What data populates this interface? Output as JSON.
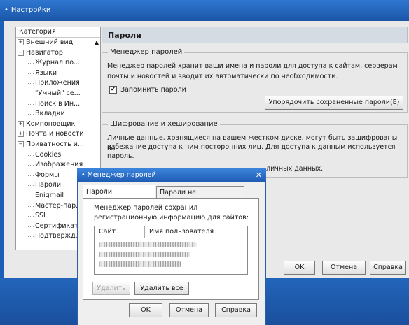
{
  "window": {
    "title": "Настройки"
  },
  "tree": {
    "header": "Категория",
    "items": [
      {
        "label": "Внешний вид",
        "level": 0,
        "expander": "+"
      },
      {
        "label": "Навигатор",
        "level": 0,
        "expander": "−"
      },
      {
        "label": "Журнал по...",
        "level": 1,
        "expander": ""
      },
      {
        "label": "Языки",
        "level": 1,
        "expander": ""
      },
      {
        "label": "Приложения",
        "level": 1,
        "expander": ""
      },
      {
        "label": "\"Умный\" се...",
        "level": 1,
        "expander": ""
      },
      {
        "label": "Поиск в Ин...",
        "level": 1,
        "expander": ""
      },
      {
        "label": "Вкладки",
        "level": 1,
        "expander": ""
      },
      {
        "label": "Компоновщик",
        "level": 0,
        "expander": "+"
      },
      {
        "label": "Почта и новости",
        "level": 0,
        "expander": "+"
      },
      {
        "label": "Приватность и...",
        "level": 0,
        "expander": "−"
      },
      {
        "label": "Cookies",
        "level": 1,
        "expander": ""
      },
      {
        "label": "Изображения",
        "level": 1,
        "expander": ""
      },
      {
        "label": "Формы",
        "level": 1,
        "expander": ""
      },
      {
        "label": "Пароли",
        "level": 1,
        "expander": ""
      },
      {
        "label": "Enigmail",
        "level": 1,
        "expander": ""
      },
      {
        "label": "Мастер-пар...",
        "level": 1,
        "expander": ""
      },
      {
        "label": "SSL",
        "level": 1,
        "expander": ""
      },
      {
        "label": "Сертификаты",
        "level": 1,
        "expander": ""
      },
      {
        "label": "Подтвержд...",
        "level": 1,
        "expander": ""
      }
    ]
  },
  "panel": {
    "title": "Пароли",
    "manager": {
      "legend": "Менеджер паролей",
      "text1": "Менеджер паролей хранит ваши имена и пароли для доступа к сайтам, серверам",
      "text2": "почты и новостей и вводит их автоматически по необходимости.",
      "remember_label": "Запомнить пароли",
      "remember_checked": true,
      "manage_button": "Упорядочить сохраненные пароли(E)"
    },
    "encryption": {
      "legend": "Шифрование и хеширование",
      "text1": "Личные данные, хранящиеся на вашем жестком диске, могут быть зашифрованы во",
      "text2": "избежание доступа к ним посторонних лиц. Для доступа к данным используется",
      "text3": "пароль.",
      "text4": "личных данных."
    }
  },
  "main_buttons": {
    "ok": "OK",
    "cancel": "Отмена",
    "help": "Справка"
  },
  "dialog": {
    "title": "Менеджер паролей",
    "tabs": [
      "Пароли сохранены",
      "Пароли не сохранялись"
    ],
    "description1": "Менеджер паролей сохранил",
    "description2": "регистрационную информацию для сайтов:",
    "columns": [
      "Сайт",
      "Имя пользователя"
    ],
    "remove_button": "Удалить",
    "remove_all_button": "Удалить все",
    "ok": "OK",
    "cancel": "Отмена",
    "help": "Справка"
  },
  "colors": {
    "titlebar": "#1b56a8",
    "desktop": "#1d5fb6",
    "panel_header": "#d5dbe3"
  }
}
